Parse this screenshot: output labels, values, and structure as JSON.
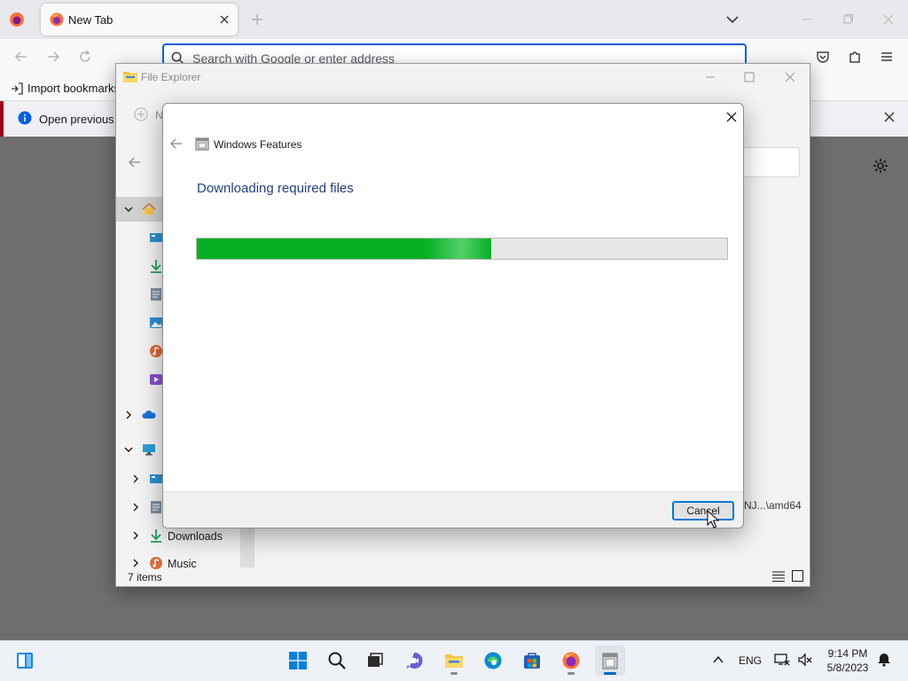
{
  "browser": {
    "tab_title": "New Tab",
    "url_placeholder": "Search with Google or enter address",
    "import_bookmarks_label": "Import bookmarks...",
    "notification_text": "Open previous t"
  },
  "explorer": {
    "title": "File Explorer",
    "new_label": "N",
    "tree": [
      {
        "name": "home",
        "label": ""
      },
      {
        "name": "desktop",
        "label": ""
      },
      {
        "name": "downloads-quick",
        "label": ""
      },
      {
        "name": "documents",
        "label": ""
      },
      {
        "name": "pictures",
        "label": ""
      },
      {
        "name": "music-quick",
        "label": ""
      },
      {
        "name": "videos",
        "label": ""
      },
      {
        "name": "onedrive",
        "label": ""
      },
      {
        "name": "this-pc",
        "label": ""
      },
      {
        "name": "desktop-pc",
        "label": ""
      },
      {
        "name": "documents-pc",
        "label": ""
      },
      {
        "name": "downloads",
        "label": "Downloads"
      },
      {
        "name": "music",
        "label": "Music"
      }
    ],
    "status_items": "7 items",
    "path_snippet": "NJ...\\amd64"
  },
  "dialog": {
    "app_title": "Windows Features",
    "heading": "Downloading required files",
    "progress_fraction": 0.555,
    "cancel_label": "Cancel"
  },
  "taskbar": {
    "language": "ENG",
    "time": "9:14 PM",
    "date": "5/8/2023"
  },
  "colors": {
    "progress_green": "#06b025",
    "heading_blue": "#1f3f8a",
    "accent_blue": "#0078d7",
    "firefox_notification_red": "#a3001c"
  }
}
